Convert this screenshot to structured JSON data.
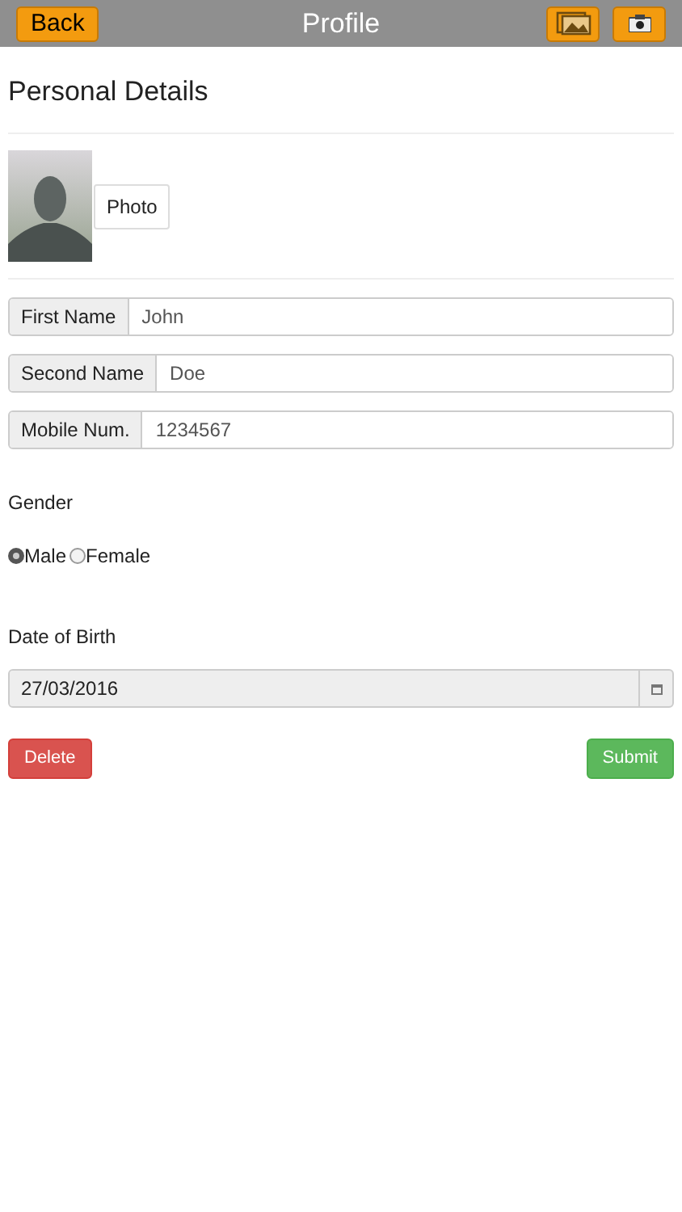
{
  "header": {
    "back": "Back",
    "title": "Profile"
  },
  "section_title": "Personal Details",
  "photo_button": "Photo",
  "fields": [
    {
      "label": "First Name",
      "value": "John"
    },
    {
      "label": "Second Name",
      "value": "Doe"
    },
    {
      "label": "Mobile Num.",
      "value": "1234567"
    }
  ],
  "gender": {
    "label": "Gender",
    "options": [
      {
        "label": "Male",
        "selected": true
      },
      {
        "label": "Female",
        "selected": false
      }
    ]
  },
  "date_of_birth": {
    "label": "Date of Birth",
    "value": "27/03/2016"
  },
  "buttons": {
    "delete": "Delete",
    "submit": "Submit"
  }
}
